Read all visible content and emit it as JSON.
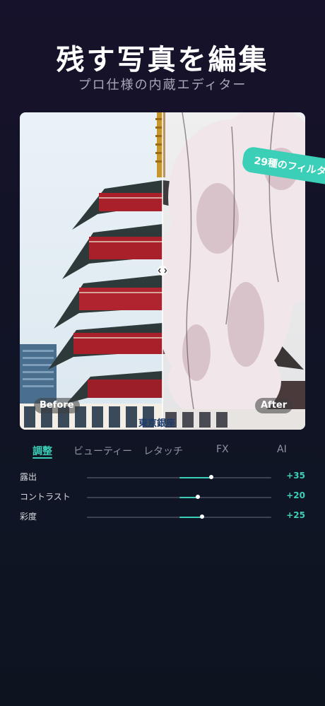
{
  "hero": {
    "title": "残す写真を編集",
    "subtitle": "プロ仕様の内蔵エディター"
  },
  "preview": {
    "filter_badge": "29種のフィルタ",
    "before_label": "Before",
    "after_label": "After",
    "sign_text": "東京銀座"
  },
  "tabs": [
    {
      "label": "調整",
      "active": true
    },
    {
      "label": "ビューティー",
      "active": false
    },
    {
      "label": "レタッチ",
      "active": false
    },
    {
      "label": "FX",
      "active": false
    },
    {
      "label": "AI",
      "active": false
    }
  ],
  "adjustments": [
    {
      "label": "露出",
      "value": "+35",
      "level": 35
    },
    {
      "label": "コントラスト",
      "value": "+20",
      "level": 20
    },
    {
      "label": "彩度",
      "value": "+25",
      "level": 25
    }
  ],
  "colors": {
    "accent": "#3ccfb8",
    "pagoda_red": "#a9202a",
    "blossom": "#f1e6ea"
  }
}
